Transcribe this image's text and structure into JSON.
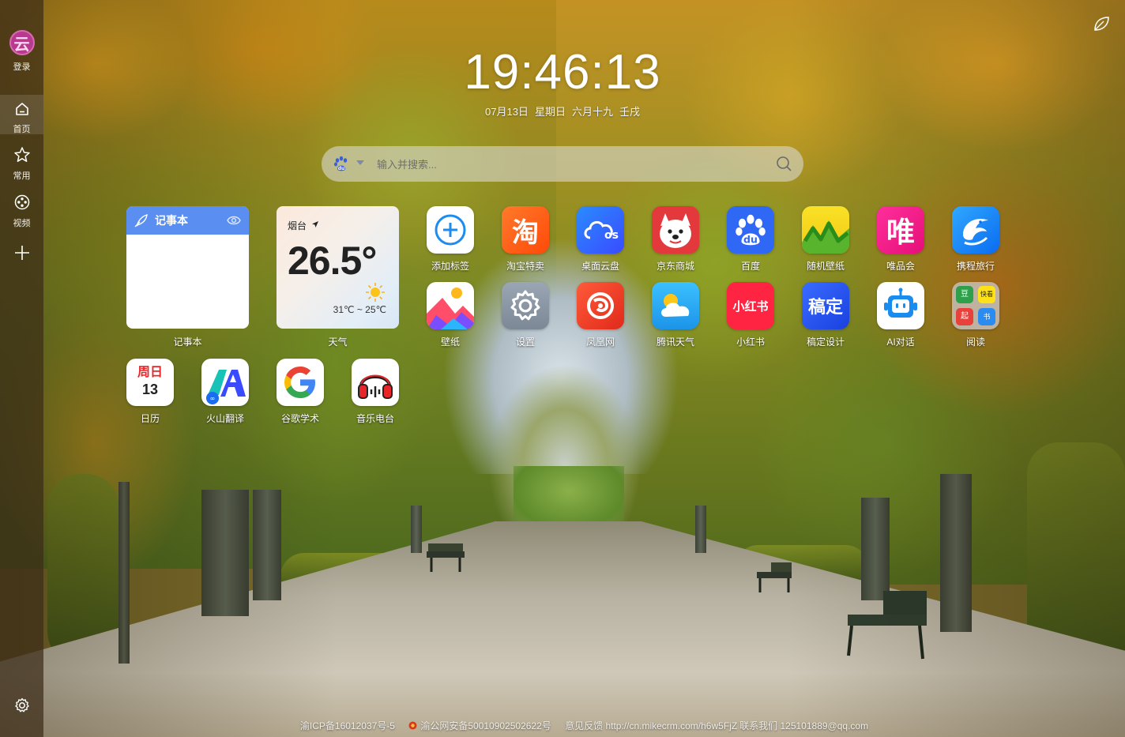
{
  "sidebar": {
    "avatar_glyph": "云",
    "login": "登录",
    "items": [
      {
        "label": "首页",
        "icon": "home-icon"
      },
      {
        "label": "常用",
        "icon": "star-icon"
      },
      {
        "label": "视频",
        "icon": "film-reel-icon"
      }
    ],
    "add_icon": "plus-icon",
    "settings_icon": "gear-icon"
  },
  "clock": {
    "time": "19:46:13",
    "date": "07月13日",
    "weekday": "星期日",
    "lunar": "六月十九",
    "ganzhi": "壬戌"
  },
  "search": {
    "placeholder": "输入并搜索...",
    "engine_icon": "baidu-paw-icon"
  },
  "widgets": {
    "notebook": {
      "title": "记事本",
      "label": "记事本"
    },
    "weather": {
      "city": "烟台",
      "temp": "26.5°",
      "range": "31℃ ~ 25℃",
      "label": "天气"
    },
    "calendar": {
      "weekday": "周日",
      "day": "13",
      "label": "日历"
    }
  },
  "apps": [
    {
      "name": "添加标签",
      "icon": "add-circle-icon",
      "color": "#ffffff"
    },
    {
      "name": "淘宝特卖",
      "icon": "taobao-icon",
      "color": "#ff5a1f",
      "glyph": "淘"
    },
    {
      "name": "桌面云盘",
      "icon": "cloud-os-icon",
      "color": "#2f6bff"
    },
    {
      "name": "京东商城",
      "icon": "jd-dog-icon",
      "color": "#e4393c"
    },
    {
      "name": "百度",
      "icon": "baidu-paw-icon",
      "color": "#2f68f5"
    },
    {
      "name": "随机壁纸",
      "icon": "random-wallpaper-icon",
      "color": "#f6d91f"
    },
    {
      "name": "唯品会",
      "icon": "vip-icon",
      "color": "#f0198a",
      "glyph": "唯"
    },
    {
      "name": "携程旅行",
      "icon": "ctrip-dolphin-icon",
      "color": "#1a8cff"
    },
    {
      "name": "壁纸",
      "icon": "picture-icon",
      "color": "#ffffff"
    },
    {
      "name": "设置",
      "icon": "settings-gear-icon",
      "color": "#8a96a6"
    },
    {
      "name": "凤凰网",
      "icon": "ifeng-icon",
      "color": "#e8402a"
    },
    {
      "name": "腾讯天气",
      "icon": "weather-cloud-icon",
      "color": "#27a9f0"
    },
    {
      "name": "小红书",
      "icon": "xiaohongshu-icon",
      "color": "#ff2442",
      "glyph": "小红书"
    },
    {
      "name": "稿定设计",
      "icon": "gaoding-icon",
      "color": "#2254f4",
      "glyph": "稿定"
    },
    {
      "name": "AI对话",
      "icon": "robot-icon",
      "color": "#ffffff"
    },
    {
      "name": "阅读",
      "icon": "reading-folder-icon",
      "color": "#b9b1a6",
      "mini": [
        "豆",
        "快看",
        "起",
        "书"
      ]
    },
    {
      "name": "火山翻译",
      "icon": "translate-icon",
      "color": "#ffffff"
    },
    {
      "name": "谷歌学术",
      "icon": "google-icon",
      "color": "#ffffff"
    },
    {
      "name": "音乐电台",
      "icon": "headphones-icon",
      "color": "#ffffff"
    }
  ],
  "footer": {
    "icp": "渝ICP备16012037号-5",
    "police": "渝公网安备50010902502622号",
    "feedback": "意见反馈 http://cn.mikecrm.com/h6w5FjZ",
    "contact": "联系我们 125101889@qq.com"
  },
  "top_right_icon": "leaf-icon"
}
